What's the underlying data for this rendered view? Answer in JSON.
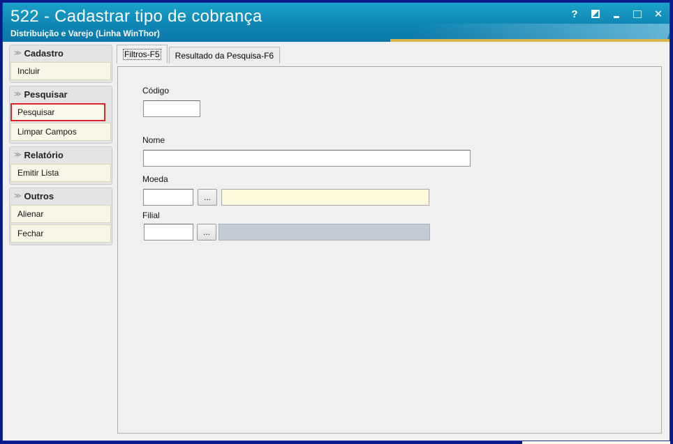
{
  "window": {
    "title": "522 - Cadastrar tipo de cobrança",
    "subtitle": "Distribuição e Varejo (Linha WinThor)",
    "controls": {
      "help": "?",
      "close": "✕"
    }
  },
  "sidebar": {
    "groups": [
      {
        "header": "Cadastro",
        "actions": [
          "Incluir"
        ]
      },
      {
        "header": "Pesquisar",
        "actions": [
          "Pesquisar",
          "Limpar Campos"
        ]
      },
      {
        "header": "Relatório",
        "actions": [
          "Emitir Lista"
        ]
      },
      {
        "header": "Outros",
        "actions": [
          "Alienar",
          "Fechar"
        ]
      }
    ]
  },
  "tabs": [
    {
      "label": "Filtros-F5",
      "active": true
    },
    {
      "label": "Resultado da Pesquisa-F6",
      "active": false
    }
  ],
  "form": {
    "codigo": {
      "label": "Código",
      "value": ""
    },
    "nome": {
      "label": "Nome",
      "value": ""
    },
    "moeda": {
      "label": "Moeda",
      "code": "",
      "button": "...",
      "description": ""
    },
    "filial": {
      "label": "Filial",
      "code": "",
      "button": "...",
      "description": ""
    }
  },
  "colors": {
    "title_bar": "#0f86b4",
    "highlight": "#d9232d",
    "yellow_field": "#fdfbdc",
    "gray_field": "#c3ccd6"
  }
}
